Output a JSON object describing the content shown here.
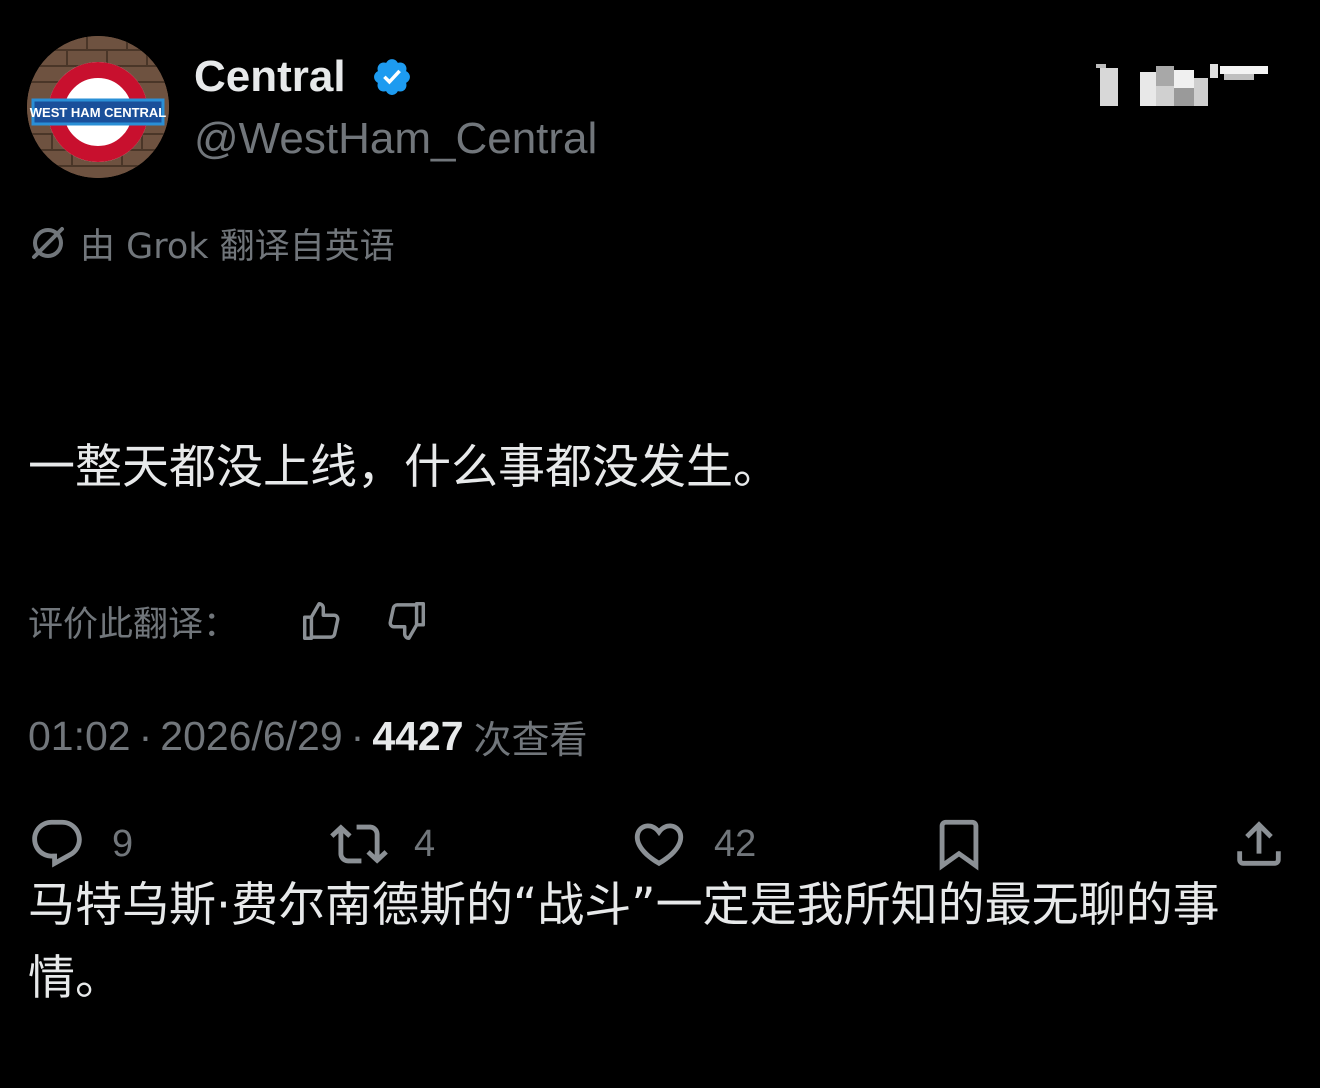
{
  "author": {
    "display_name": "Central",
    "handle": "@WestHam_Central",
    "avatar_sign_text": "WEST HAM CENTRAL"
  },
  "translation": {
    "note": "由 Grok 翻译自英语",
    "icon": "grok-icon",
    "rate_label": "评价此翻译："
  },
  "tweet": {
    "paragraph_1": "一整天都没上线，什么事都没发生。",
    "paragraph_2": "马特乌斯·费尔南德斯的“战斗”一定是我所知的最无聊的事情。"
  },
  "meta": {
    "time": "01:02",
    "date": "2026/6/29",
    "separator": "·",
    "views_count": "4427",
    "views_label": "次查看"
  },
  "actions": {
    "reply_count": "9",
    "repost_count": "4",
    "like_count": "42"
  },
  "colors": {
    "background": "#000000",
    "text_primary": "#e7e9ea",
    "text_secondary": "#71767b",
    "verified_badge": "#1d9bf0"
  }
}
